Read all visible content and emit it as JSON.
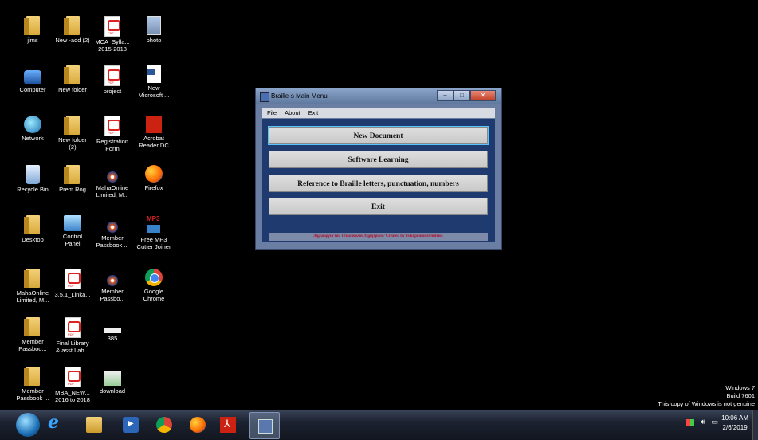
{
  "desktop_icons": [
    {
      "label": "jims",
      "icon": "folder-icon"
    },
    {
      "label": "New -add (2)",
      "icon": "folder-icon"
    },
    {
      "label": "MCA_Sylla...\n2015-2018",
      "icon": "pdf-icon"
    },
    {
      "label": "photo",
      "icon": "image-icon"
    },
    {
      "label": "Computer",
      "icon": "computer-icon"
    },
    {
      "label": "New folder",
      "icon": "folder-icon"
    },
    {
      "label": "project",
      "icon": "pdf-icon"
    },
    {
      "label": "New\nMicrosoft ...",
      "icon": "document-icon"
    },
    {
      "label": "Network",
      "icon": "network-icon"
    },
    {
      "label": "New folder\n(2)",
      "icon": "folder-icon"
    },
    {
      "label": "Registration\nForm",
      "icon": "pdf-icon"
    },
    {
      "label": "Acrobat\nReader DC",
      "icon": "acrobat-icon"
    },
    {
      "label": "Recycle Bin",
      "icon": "recycle-bin-icon"
    },
    {
      "label": "Prem Rog",
      "icon": "folder-icon"
    },
    {
      "label": "MahaOnline\nLimited, M...",
      "icon": "mahaonline-icon"
    },
    {
      "label": "Firefox",
      "icon": "firefox-icon"
    },
    {
      "label": "Desktop",
      "icon": "folder-icon"
    },
    {
      "label": "Control\nPanel",
      "icon": "control-panel-icon"
    },
    {
      "label": "Member\nPassbook ...",
      "icon": "mahaonline-icon"
    },
    {
      "label": "Free MP3\nCutter Joiner",
      "icon": "mp3-icon"
    },
    {
      "label": "MahaOnline\nLimited, M...",
      "icon": "folder-icon"
    },
    {
      "label": "3.5.1_Linka...",
      "icon": "pdf-icon"
    },
    {
      "label": "Member\nPassbo...",
      "icon": "mahaonline-icon"
    },
    {
      "label": "Google\nChrome",
      "icon": "chrome-icon"
    },
    {
      "label": "Member\nPassboo...",
      "icon": "folder-icon"
    },
    {
      "label": "Final Library\n& asst Lab...",
      "icon": "pdf-icon"
    },
    {
      "label": "385",
      "icon": "image-icon"
    },
    {
      "label": "Member\nPassbook ...",
      "icon": "folder-icon"
    },
    {
      "label": "MBA_NEW...\n2016 to 2018",
      "icon": "pdf-icon"
    },
    {
      "label": "download",
      "icon": "image-icon"
    }
  ],
  "window": {
    "title": "Braille-s Main Menu",
    "controls": {
      "minimize": "–",
      "maximize": "□",
      "close": "✕"
    },
    "menu": [
      "File",
      "About",
      "Exit"
    ],
    "buttons": [
      "New Document",
      "Software Learning",
      "Reference to Braille letters, punctuation, numbers",
      "Exit"
    ],
    "credit": "Δημιουργία του Τσικόπουλου Δημήτριου / Created by Tsikopoulos Dimitrios"
  },
  "watermark": {
    "line1": "Windows 7",
    "line2": "Build 7601",
    "line3": "This copy of Windows is not genuine"
  },
  "taskbar": {
    "items": [
      "start-orb",
      "internet-explorer",
      "windows-explorer",
      "media-player",
      "google-chrome",
      "firefox",
      "acrobat-reader",
      "braille-app"
    ],
    "clock": {
      "time": "10:06 AM",
      "date": "2/6/2019"
    }
  }
}
